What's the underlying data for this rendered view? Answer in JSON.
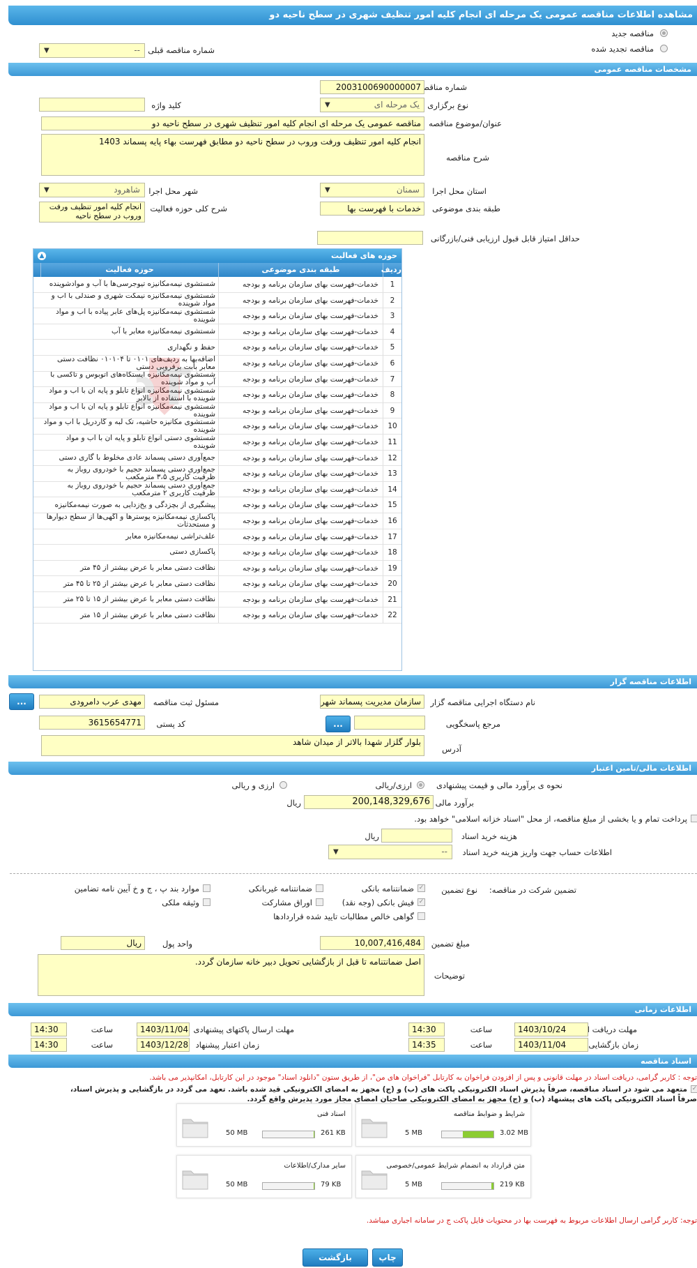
{
  "page": {
    "title": "مشاهده اطلاعات مناقصه عمومی یک مرحله ای انجام کلیه امور تنظیف شهری در سطح ناحیه دو"
  },
  "top": {
    "new_tender": "مناقصه جدید",
    "renewed_tender": "مناقصه تجدید شده",
    "prev_number_label": "شماره مناقصه قبلی",
    "prev_number_value": "--"
  },
  "general": {
    "section": "مشخصات مناقصه عمومی",
    "number_label": "شماره مناقصه",
    "number_value": "2003100690000007",
    "type_label": "نوع برگزاری",
    "type_value": "یک مرحله ای",
    "keyword_label": "کلید واژه",
    "keyword_value": "",
    "subject_label": "عنوان/موضوع مناقصه",
    "subject_value": "مناقصه عمومی یک مرحله ای انجام کلیه امور تنظیف شهری در سطح ناحیه دو",
    "desc_label": "شرح مناقصه",
    "desc_value": "انجام  کلیه امور تنظیف ورفت وروب در سطح ناحیه دو مطابق فهرست بهاء پایه پسماند 1403",
    "province_label": "استان محل اجرا",
    "province_value": "سمنان",
    "city_label": "شهر محل اجرا",
    "city_value": "شاهرود",
    "category_label": "طبقه بندی موضوعی",
    "category_value": "خدمات با فهرست بها",
    "scope_label": "شرح کلی حوزه فعالیت",
    "scope_value": "انجام  کلیه امور تنظیف ورفت وروب در سطح ناحیه",
    "min_score_label": "حداقل امتیاز قابل قبول ارزیابی فنی/بازرگانی",
    "min_score_value": ""
  },
  "activity_table": {
    "title": "حوزه های فعالیت",
    "col_num": "ردیف",
    "col_cat": "طبقه بندی موضوعی",
    "col_act": "حوزه فعالیت",
    "rows": [
      {
        "n": "1",
        "cat": "خدمات-فهرست بهای سازمان برنامه و بودجه",
        "act": "شستشوی نیمه‌مکانیزه تیوجرسی‌ها با آب و موادشوینده"
      },
      {
        "n": "2",
        "cat": "خدمات-فهرست بهای سازمان برنامه و بودجه",
        "act": "شستشوی نیمه‌مکانیزه نیمکت شهری و صندلی با آب و مواد شوینده"
      },
      {
        "n": "3",
        "cat": "خدمات-فهرست بهای سازمان برنامه و بودجه",
        "act": "شستشوی نیمه‌مکانیزه پل‌های عابر پیاده با آب و مواد شوینده"
      },
      {
        "n": "4",
        "cat": "خدمات-فهرست بهای سازمان برنامه و بودجه",
        "act": "شستشوی نیمه‌مکانیزه معابر با آب"
      },
      {
        "n": "5",
        "cat": "خدمات-فهرست بهای سازمان برنامه و بودجه",
        "act": "حفظ و نگهداری"
      },
      {
        "n": "6",
        "cat": "خدمات-فهرست بهای سازمان برنامه و بودجه",
        "act": "اضافه‌بها به ردیف‌های ۰۱۰۱ تا ۰۱۰۱۰۴ نظافت دستی معابر بابت برفروبی دستی"
      },
      {
        "n": "7",
        "cat": "خدمات-فهرست بهای سازمان برنامه و بودجه",
        "act": "شستشوی نیمه‌مکانیزه ایستگاه‌های اتوبوس و تاکسی با آب و مواد شوینده"
      },
      {
        "n": "8",
        "cat": "خدمات-فهرست بهای سازمان برنامه و بودجه",
        "act": "شستشوی نیمه‌مکانیزه انواع تابلو و پایه آن با آب و مواد شوینده با استفاده از بالابر"
      },
      {
        "n": "9",
        "cat": "خدمات-فهرست بهای سازمان برنامه و بودجه",
        "act": "شستشوی نیمه‌مکانیزه انواع تابلو و پایه آن با آب و مواد شوینده"
      },
      {
        "n": "10",
        "cat": "خدمات-فهرست بهای سازمان برنامه و بودجه",
        "act": "شستشوی مکانیزه حاشیه، تک لبه و گاردریل با آب و مواد شوینده"
      },
      {
        "n": "11",
        "cat": "خدمات-فهرست بهای سازمان برنامه و بودجه",
        "act": "شستشوی دستی انواع تابلو و پایه آن با آب و مواد شوینده"
      },
      {
        "n": "12",
        "cat": "خدمات-فهرست بهای سازمان برنامه و بودجه",
        "act": "جمع‌آوری دستی پسماند عادی مخلوط با گاری دستی"
      },
      {
        "n": "13",
        "cat": "خدمات-فهرست بهای سازمان برنامه و بودجه",
        "act": "جمع‌آوری دستی پسماند حجیم با خودروی روباز به ظرفیت کاربری ۳،۵ مترمکعب"
      },
      {
        "n": "14",
        "cat": "خدمات-فهرست بهای سازمان برنامه و بودجه",
        "act": "جمع‌آوری دستی پسماند حجیم با خودروی روباز به ظرفیت کاربری ۲ مترمکعب"
      },
      {
        "n": "15",
        "cat": "خدمات-فهرست بهای سازمان برنامه و بودجه",
        "act": "پیشگیری از بچزدگی و یخ‌زدایی به صورت نیمه‌مکانیزه"
      },
      {
        "n": "16",
        "cat": "خدمات-فهرست بهای سازمان برنامه و بودجه",
        "act": "پاکسازی نیمه‌مکانیزه پوسترها و آگهی‌ها از سطح دیوارها و مستحدثات"
      },
      {
        "n": "17",
        "cat": "خدمات-فهرست بهای سازمان برنامه و بودجه",
        "act": "علف‌تراشی نیمه‌مکانیزه معابر"
      },
      {
        "n": "18",
        "cat": "خدمات-فهرست بهای سازمان برنامه و بودجه",
        "act": "پاکسازی دستی"
      },
      {
        "n": "19",
        "cat": "خدمات-فهرست بهای سازمان برنامه و بودجه",
        "act": "نظافت دستی معابر با عرض بیشتر از ۴۵ متر"
      },
      {
        "n": "20",
        "cat": "خدمات-فهرست بهای سازمان برنامه و بودجه",
        "act": "نظافت دستی معابر با عرض بیشتر از ۲۵ تا ۴۵ متر"
      },
      {
        "n": "21",
        "cat": "خدمات-فهرست بهای سازمان برنامه و بودجه",
        "act": "نظافت دستی معابر با عرض بیشتر از ۱۵ تا ۲۵ متر"
      },
      {
        "n": "22",
        "cat": "خدمات-فهرست بهای سازمان برنامه و بودجه",
        "act": "نظافت دستی معابر با عرض بیشتر از ۱۵ متر"
      }
    ]
  },
  "organizer": {
    "section": "اطلاعات مناقصه گزار",
    "org_label": "نام دستگاه اجرایی مناقصه گزار",
    "org_value": "سازمان مدیریت پسماند شهرداری شاهرود",
    "resp_label": "مسئول ثبت مناقصه",
    "resp_value": "مهدی عرب دامرودی",
    "ref_label": "مرجع پاسخگویی",
    "ref_value": "",
    "postal_label": "کد پستی",
    "postal_value": "3615654771",
    "address_label": "آدرس",
    "address_value": "بلوار گلزار شهدا بالاتر از میدان شاهد",
    "more_btn": "..."
  },
  "finance": {
    "section": "اطلاعات مالی/تامین اعتبار",
    "method_label": "نحوه ی برآورد مالی و قیمت پیشنهادی",
    "opt_rial": "ارزی/ریالی",
    "opt_both": "ارزی و ریالی",
    "estimate_label": "برآورد مالی",
    "estimate_value": "200,148,329,676",
    "rial": "ریال",
    "treasury_text": "پرداخت تمام و یا بخشی از مبلغ مناقصه، از محل \"اسناد خزانه اسلامی\" خواهد بود.",
    "doc_cost_label": "هزینه خرید اسناد",
    "doc_cost_value": "",
    "account_label": "اطلاعات حساب جهت واریز هزینه خرید اسناد",
    "account_value": "--"
  },
  "guarantee": {
    "section_label": "تضمین شرکت در مناقصه:",
    "type_label": "نوع تضمین",
    "bank_guarantee": "ضمانتنامه بانکی",
    "nonbank_guarantee": "ضمانتنامه غیربانکی",
    "clause": "موارد بند پ ، ج و خ آیین نامه تضامین",
    "bank_receipt": "فیش بانکی (وجه نقد)",
    "bonds": "اوراق مشارکت",
    "property": "وثیقه ملکی",
    "claims": "گواهی خالص مطالبات تایید شده قراردادها",
    "amount_label": "مبلغ تضمین",
    "amount_value": "10,007,416,484",
    "unit_label": "واحد پول",
    "unit_value": "ریال",
    "notes_label": "توضیحات",
    "notes_value": "اصل ضمانتنامه تا قبل از بازگشایی  تحویل دبیر خانه سازمان گردد."
  },
  "timing": {
    "section": "اطلاعات زمانی",
    "receive_label": "مهلت دریافت اسناد",
    "receive_date": "1403/10/24",
    "receive_time": "14:30",
    "send_label": "مهلت ارسال پاکتهای پیشنهادی",
    "send_date": "1403/11/04",
    "send_time": "14:30",
    "open_label": "زمان بازگشایی پاکت ها",
    "open_date": "1403/11/04",
    "open_time": "14:35",
    "valid_label": "زمان اعتبار پیشنهاد",
    "valid_date": "1403/12/28",
    "valid_time": "14:30",
    "time_label": "ساعت"
  },
  "documents": {
    "section": "اسناد مناقصه",
    "note1": "توجه : کاربر گرامی، دریافت اسناد در مهلت قانونی و پس از افزودن فراخوان به کارتابل \"فراخوان های من\"، از طریق ستون \"دانلود اسناد\" موجود در این کارتابل، امکانپذیر می باشد.",
    "commit1": "متعهد می شود در اسناد مناقصه، صرفاً پذیرش اسناد الکترونیکی پاکت های (ب) و (ج) مجهز به امضای الکترونیکی قید شده باشد. تعهد می گردد در بازگشایی و پذیرش اسناد،",
    "commit2": "صرفاً اسناد الکترونیکی پاکت های پیشنهاد (ب) و (ج) مجهز به امضای الکترونیکی صاحبان امضای مجاز مورد پذیرش واقع گردد.",
    "files": [
      {
        "name": "شرایط و ضوابط مناقصه",
        "max": "5 MB",
        "size": "3.02 MB",
        "pct": 60
      },
      {
        "name": "اسناد فنی",
        "max": "50 MB",
        "size": "261 KB",
        "pct": 1
      },
      {
        "name": "متن قرارداد به انضمام شرایط عمومی/خصوصی",
        "max": "5 MB",
        "size": "219 KB",
        "pct": 4
      },
      {
        "name": "سایر مدارک/اطلاعات",
        "max": "50 MB",
        "size": "79 KB",
        "pct": 1
      }
    ],
    "note2": "توجه: کاربر گرامی ارسال اطلاعات مربوط به فهرست بها در محتویات فایل پاکت ج در سامانه اجباری میباشد."
  },
  "footer": {
    "back": "بازگشت",
    "print": "چاپ"
  },
  "colors": {
    "accent": "#2f8fd0",
    "field": "#ffffc4",
    "warning": "#d51b1b",
    "progress": "#8ccc33"
  }
}
